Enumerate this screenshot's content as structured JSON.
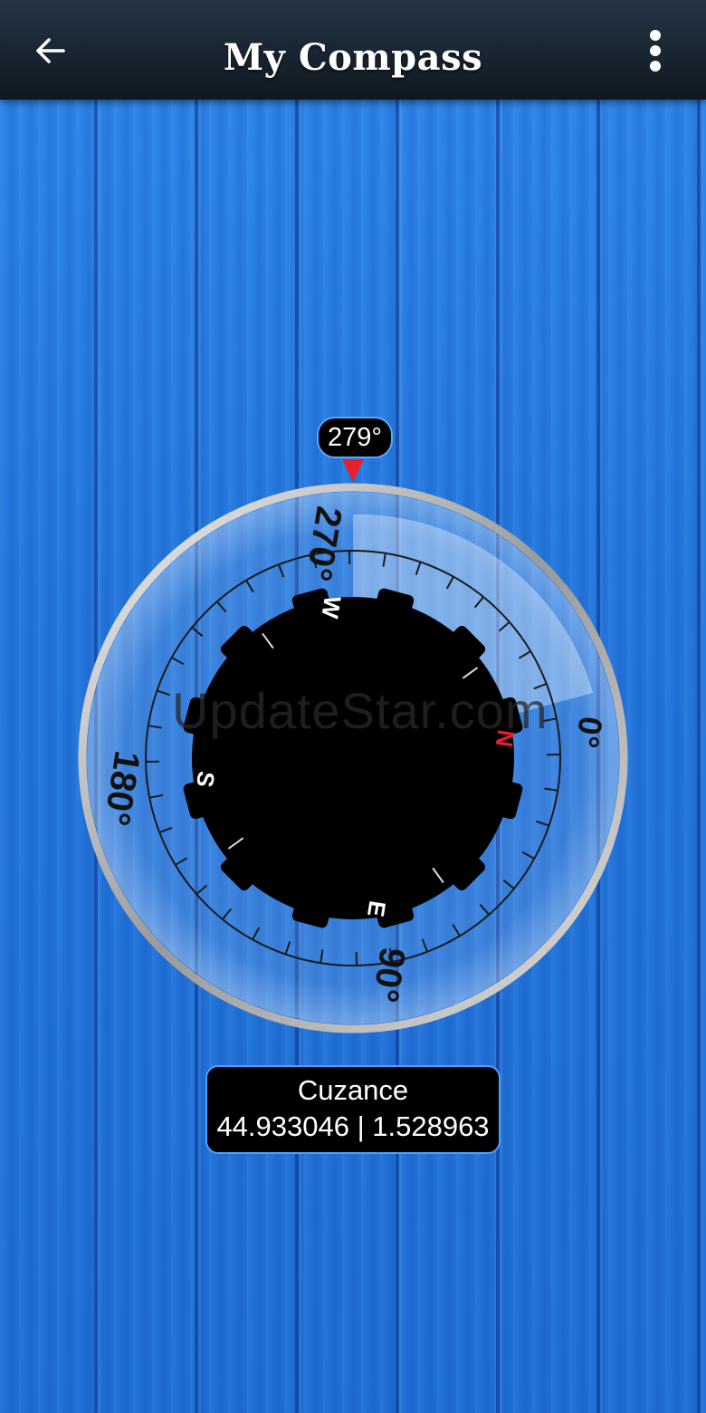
{
  "header": {
    "title": "My Compass",
    "back_icon": "arrow-left-icon",
    "menu_icon": "more-vert-icon"
  },
  "compass": {
    "heading": "279°",
    "degree_labels": [
      "270°",
      "0°",
      "90°",
      "180°"
    ],
    "cardinals": [
      "W",
      "N",
      "E",
      "S"
    ],
    "north_color": "#e8202a"
  },
  "watermark": "UpdateStar.com",
  "location": {
    "name": "Cuzance",
    "coords": "44.933046 | 1.528963"
  },
  "colors": {
    "background": "#2a7fe4",
    "badge_border": "#5aa6ff",
    "pointer": "#e8202a"
  }
}
